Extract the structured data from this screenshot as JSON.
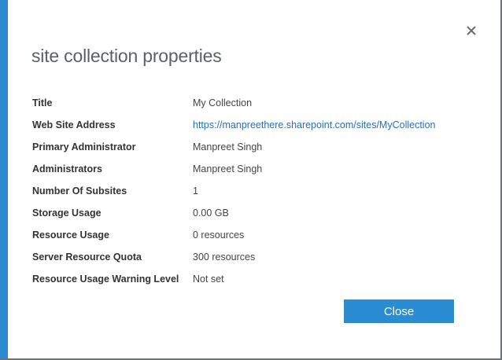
{
  "dialog": {
    "title": "site collection properties",
    "close_button": "Close",
    "colors": {
      "accent": "#2a8dd4",
      "link": "#2a6ebb"
    },
    "properties": [
      {
        "label": "Title",
        "value": "My Collection"
      },
      {
        "label": "Web Site Address",
        "value": "https://manpreethere.sharepoint.com/sites/MyCollection",
        "link": true
      },
      {
        "label": "Primary Administrator",
        "value": "Manpreet Singh"
      },
      {
        "label": "Administrators",
        "value": "Manpreet Singh"
      },
      {
        "label": "Number Of Subsites",
        "value": "1"
      },
      {
        "label": "Storage Usage",
        "value": "0.00 GB"
      },
      {
        "label": "Resource Usage",
        "value": "0 resources"
      },
      {
        "label": "Server Resource Quota",
        "value": "300 resources"
      },
      {
        "label": "Resource Usage Warning Level",
        "value": "Not set"
      }
    ]
  }
}
